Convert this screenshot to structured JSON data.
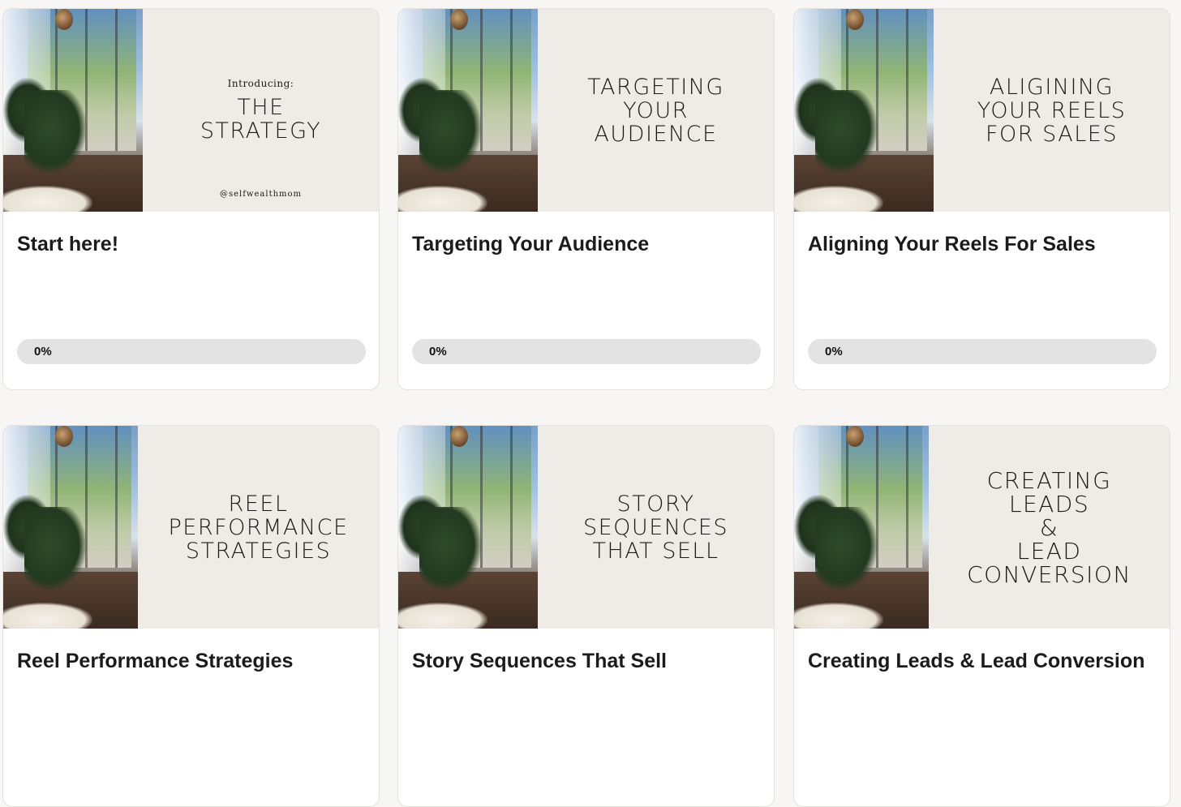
{
  "courses": [
    {
      "poster_intro": "Introducing:",
      "poster_title": "THE\nSTRATEGY",
      "poster_handle": "@selfwealthmom",
      "title": "Start here!",
      "progress_label": "0%",
      "progress_percent": 0
    },
    {
      "poster_title": "TARGETING\nYOUR\nAUDIENCE",
      "title": "Targeting Your Audience",
      "progress_label": "0%",
      "progress_percent": 0
    },
    {
      "poster_title": "ALIGINING\nYOUR REELS\nFOR SALES",
      "title": "Aligning Your Reels For Sales",
      "progress_label": "0%",
      "progress_percent": 0
    },
    {
      "poster_title": "REEL\nPERFORMANCE\nSTRATEGIES",
      "title": "Reel Performance Strategies"
    },
    {
      "poster_title": "STORY\nSEQUENCES\nTHAT SELL",
      "title": "Story Sequences That Sell"
    },
    {
      "poster_title": "CREATING\nLEADS\n&\nLEAD\nCONVERSION",
      "title": "Creating Leads & Lead Conversion"
    }
  ],
  "colors": {
    "page_background": "#f7f6f5",
    "card_background": "#ffffff",
    "poster_background": "#efebe7",
    "progress_track": "#e3e3e3",
    "text": "#1b1b1b"
  }
}
